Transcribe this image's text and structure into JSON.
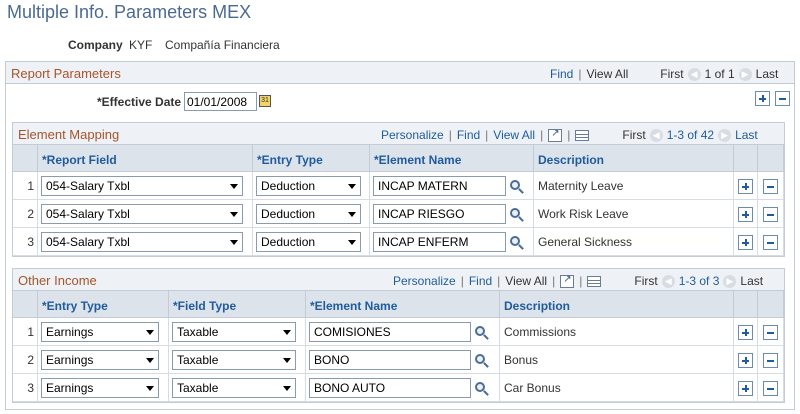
{
  "page": {
    "title": "Multiple Info. Parameters MEX"
  },
  "company": {
    "label": "Company",
    "code": "KYF",
    "name": "Compañía Financiera"
  },
  "report_parameters": {
    "title": "Report Parameters",
    "nav": {
      "find": "Find",
      "view_all": "View All",
      "first": "First",
      "range": "1 of 1",
      "last": "Last"
    },
    "effective_date": {
      "label": "*Effective Date",
      "value": "01/01/2008"
    }
  },
  "element_mapping": {
    "title": "Element Mapping",
    "nav": {
      "personalize": "Personalize",
      "find": "Find",
      "view_all": "View All",
      "first": "First",
      "range": "1-3 of 42",
      "last": "Last"
    },
    "columns": {
      "report_field": "*Report Field",
      "entry_type": "*Entry Type",
      "element_name": "*Element Name",
      "description": "Description"
    },
    "rows": [
      {
        "num": "1",
        "report_field": "054-Salary Txbl",
        "entry_type": "Deduction",
        "element_name": "INCAP MATERN",
        "description": "Maternity Leave"
      },
      {
        "num": "2",
        "report_field": "054-Salary Txbl",
        "entry_type": "Deduction",
        "element_name": "INCAP RIESGO",
        "description": "Work Risk Leave"
      },
      {
        "num": "3",
        "report_field": "054-Salary Txbl",
        "entry_type": "Deduction",
        "element_name": "INCAP ENFERM",
        "description": "General Sickness"
      }
    ]
  },
  "other_income": {
    "title": "Other Income",
    "nav": {
      "personalize": "Personalize",
      "find": "Find",
      "view_all": "View All",
      "first": "First",
      "range": "1-3 of 3",
      "last": "Last"
    },
    "columns": {
      "entry_type": "*Entry Type",
      "field_type": "*Field Type",
      "element_name": "*Element Name",
      "description": "Description"
    },
    "rows": [
      {
        "num": "1",
        "entry_type": "Earnings",
        "field_type": "Taxable",
        "element_name": "COMISIONES",
        "description": "Commissions"
      },
      {
        "num": "2",
        "entry_type": "Earnings",
        "field_type": "Taxable",
        "element_name": "BONO",
        "description": "Bonus"
      },
      {
        "num": "3",
        "entry_type": "Earnings",
        "field_type": "Taxable",
        "element_name": "BONO AUTO",
        "description": "Car Bonus"
      }
    ]
  },
  "icons": {
    "prev": "arrow-left-icon",
    "next": "arrow-right-icon",
    "zoom": "zoom-icon",
    "grid": "download-grid-icon",
    "calendar": "calendar-icon",
    "lookup": "search-icon",
    "add": "plus-icon",
    "remove": "minus-icon"
  },
  "colors": {
    "title": "#4a6a94",
    "section_title": "#a7542b",
    "link": "#1f5b9e",
    "header_bg": "#dde3ea"
  }
}
